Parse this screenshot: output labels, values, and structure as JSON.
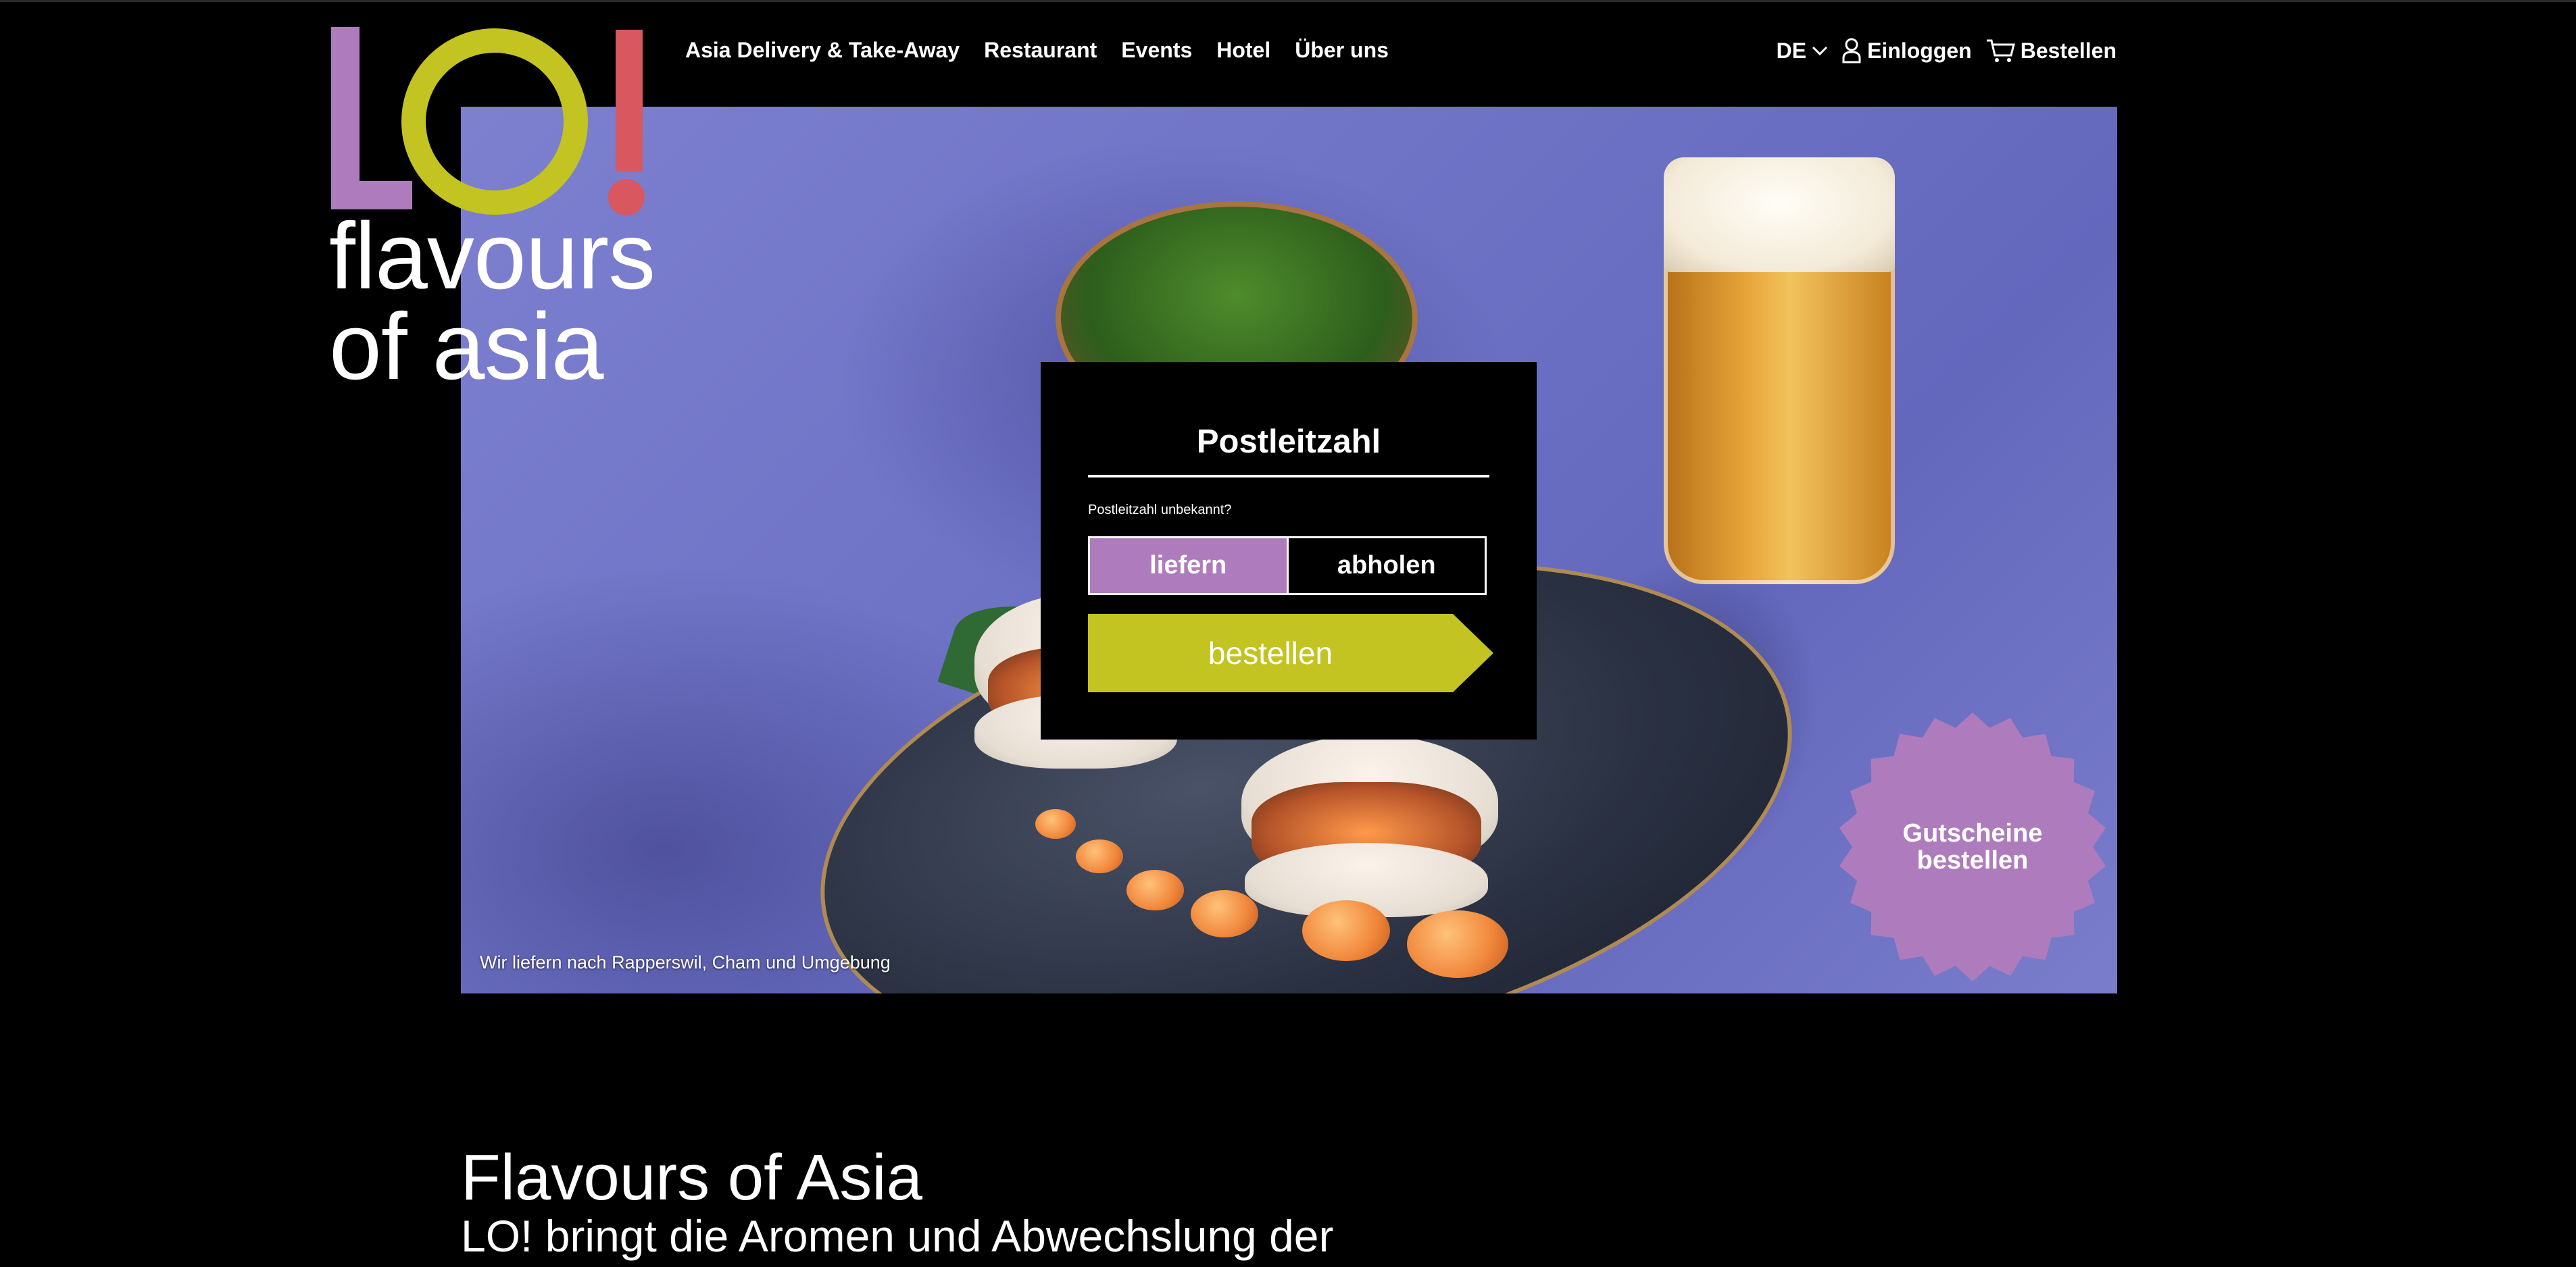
{
  "header": {
    "logo": {
      "letters": "LO!",
      "tagline": "flavours\nof asia",
      "colors": {
        "L": "#ae7cbd",
        "O": "#c3c321",
        "exclaim": "#d9575e"
      }
    },
    "nav": [
      {
        "label": "Asia Delivery & Take-Away"
      },
      {
        "label": "Restaurant"
      },
      {
        "label": "Events"
      },
      {
        "label": "Hotel"
      },
      {
        "label": "Über uns"
      }
    ],
    "language": "DE",
    "login_label": "Einloggen",
    "order_label": "Bestellen"
  },
  "hero": {
    "caption": "Wir liefern nach Rapperswil, Cham und Umgebung",
    "badge": {
      "line1": "Gutscheine",
      "line2": "bestellen",
      "color": "#ae7cbd"
    }
  },
  "order_panel": {
    "title": "Postleitzahl",
    "zip_unknown": "Postleitzahl unbekannt?",
    "toggle": {
      "deliver": "liefern",
      "pickup": "abholen",
      "active": "liefern"
    },
    "submit": "bestellen",
    "accent": "#c3c321"
  },
  "main": {
    "heading": "Flavours of Asia",
    "lead": "LO! bringt die Aromen und Abwechslung der"
  }
}
